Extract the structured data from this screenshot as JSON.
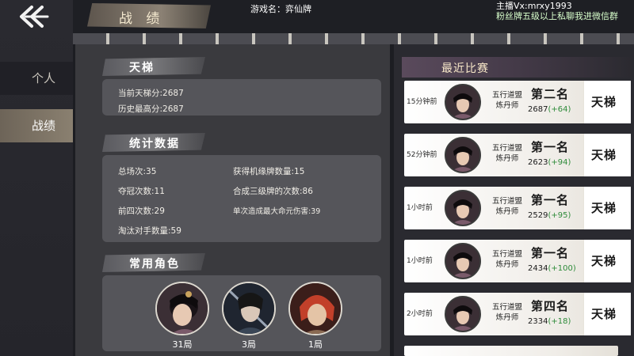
{
  "header": {
    "back_icon": "back-arrow-icon",
    "title": "战 绩",
    "game_name": "游戏名：弈仙牌",
    "streamer_line1": "主播Vx:mrxy1993",
    "streamer_line2": "粉丝牌五级以上私聊我进微信群"
  },
  "sidebar": {
    "items": [
      {
        "label": "个人"
      },
      {
        "label": "战绩"
      }
    ]
  },
  "ladder": {
    "title": "天梯",
    "current": "当前天梯分:2687",
    "highest": "历史最高分:2687"
  },
  "stats": {
    "title": "统计数据",
    "total": "总场次:35",
    "wins": "夺冠次数:11",
    "top4": "前四次数:29",
    "eliminated": "淘汰对手数量:59",
    "cards_obtained": "获得机缘牌数量:15",
    "tier3": "合成三级牌的次数:86",
    "max_damage": "单次造成最大命元伤害:39"
  },
  "characters": {
    "title": "常用角色",
    "items": [
      {
        "count": "31局"
      },
      {
        "count": "3局"
      },
      {
        "count": "1局"
      }
    ]
  },
  "recent": {
    "title": "最近比赛",
    "matches": [
      {
        "time": "15分钟前",
        "sect_line1": "五行道盟",
        "sect_line2": "炼丹师",
        "rank": "第二名",
        "score": "2687",
        "delta": "(+64)",
        "mode": "天梯"
      },
      {
        "time": "52分钟前",
        "sect_line1": "五行道盟",
        "sect_line2": "炼丹师",
        "rank": "第一名",
        "score": "2623",
        "delta": "(+94)",
        "mode": "天梯"
      },
      {
        "time": "1小时前",
        "sect_line1": "五行道盟",
        "sect_line2": "炼丹师",
        "rank": "第一名",
        "score": "2529",
        "delta": "(+95)",
        "mode": "天梯"
      },
      {
        "time": "1小时前",
        "sect_line1": "五行道盟",
        "sect_line2": "炼丹师",
        "rank": "第一名",
        "score": "2434",
        "delta": "(+100)",
        "mode": "天梯"
      },
      {
        "time": "2小时前",
        "sect_line1": "五行道盟",
        "sect_line2": "炼丹师",
        "rank": "第四名",
        "score": "2334",
        "delta": "(+18)",
        "mode": "天梯"
      }
    ]
  },
  "colors": {
    "background": "#1c1d22",
    "panel": "#3a3a3e",
    "card": "#55555a",
    "delta_green": "#2e8b3a",
    "accent_gold": "#f8e8c9"
  }
}
